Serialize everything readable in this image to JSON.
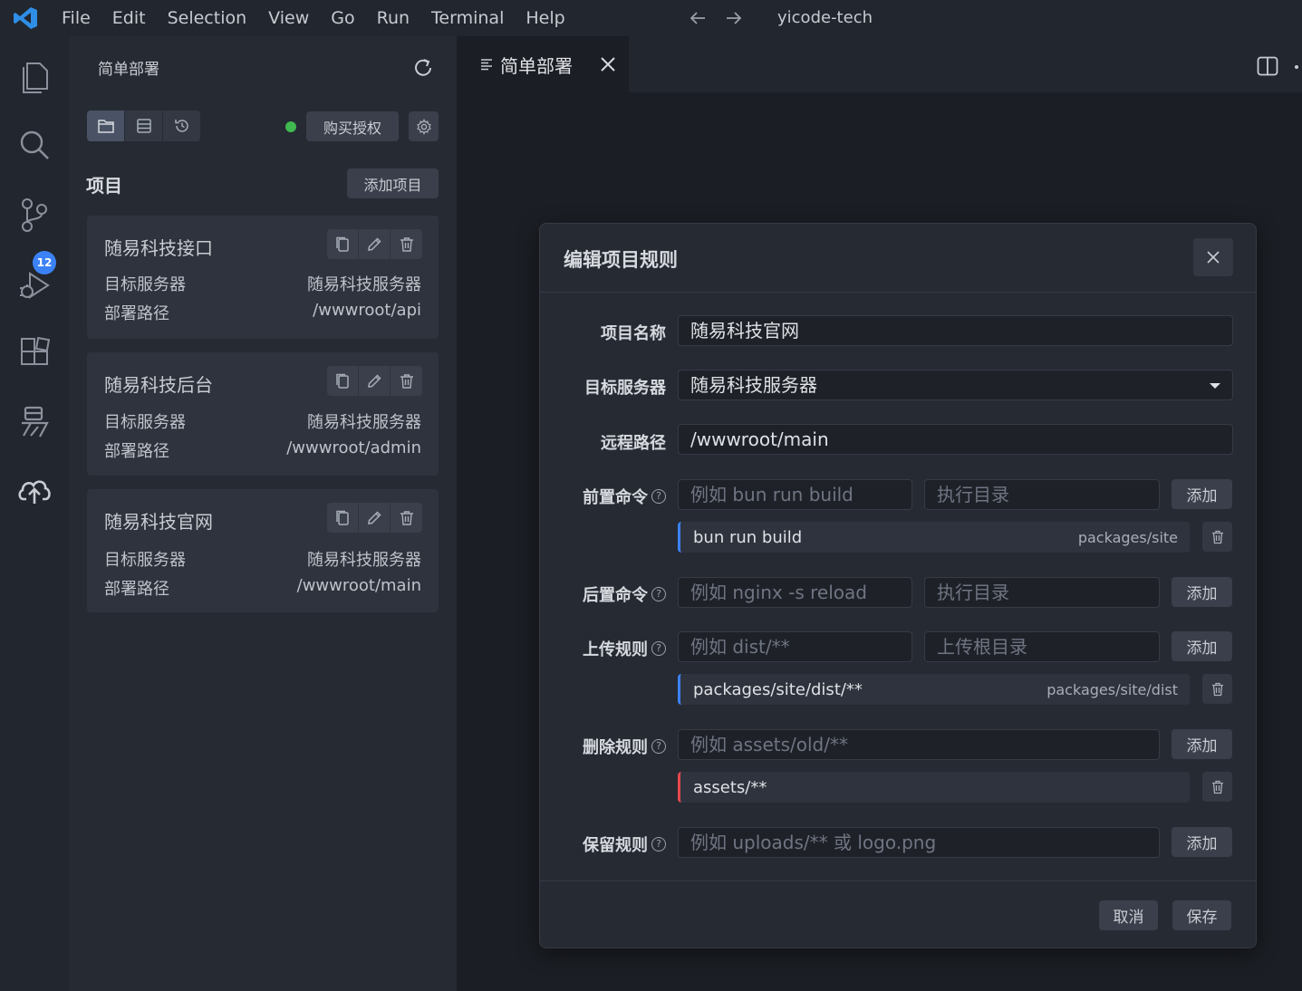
{
  "menu": [
    "File",
    "Edit",
    "Selection",
    "View",
    "Go",
    "Run",
    "Terminal",
    "Help"
  ],
  "window_title": "yicode-tech",
  "activity": {
    "scm_badge": "12"
  },
  "sidebar": {
    "title": "简单部署",
    "buy_label": "购买授权",
    "status_color": "#3fb950",
    "section_title": "项目",
    "add_project_label": "添加项目",
    "projects": [
      {
        "name": "随易科技接口",
        "server_label": "目标服务器",
        "server": "随易科技服务器",
        "path_label": "部署路径",
        "path": "/wwwroot/api"
      },
      {
        "name": "随易科技后台",
        "server_label": "目标服务器",
        "server": "随易科技服务器",
        "path_label": "部署路径",
        "path": "/wwwroot/admin"
      },
      {
        "name": "随易科技官网",
        "server_label": "目标服务器",
        "server": "随易科技服务器",
        "path_label": "部署路径",
        "path": "/wwwroot/main"
      }
    ]
  },
  "editor": {
    "tab_label": "简单部署"
  },
  "modal": {
    "title": "编辑项目规则",
    "name_label": "项目名称",
    "name_value": "随易科技官网",
    "server_label": "目标服务器",
    "server_value": "随易科技服务器",
    "remote_label": "远程路径",
    "remote_value": "/wwwroot/main",
    "pre_label": "前置命令",
    "pre_placeholder": "例如 bun run build",
    "pre_dir_placeholder": "执行目录",
    "pre_items": [
      {
        "cmd": "bun run build",
        "dir": "packages/site"
      }
    ],
    "post_label": "后置命令",
    "post_placeholder": "例如 nginx -s reload",
    "post_dir_placeholder": "执行目录",
    "upload_label": "上传规则",
    "upload_placeholder": "例如 dist/**",
    "upload_root_placeholder": "上传根目录",
    "upload_items": [
      {
        "pattern": "packages/site/dist/**",
        "root": "packages/site/dist"
      }
    ],
    "delete_label": "删除规则",
    "delete_placeholder": "例如 assets/old/**",
    "delete_items": [
      {
        "pattern": "assets/**"
      }
    ],
    "keep_label": "保留规则",
    "keep_placeholder": "例如 uploads/** 或 logo.png",
    "add_label": "添加",
    "help_glyph": "?",
    "cancel_label": "取消",
    "save_label": "保存"
  }
}
